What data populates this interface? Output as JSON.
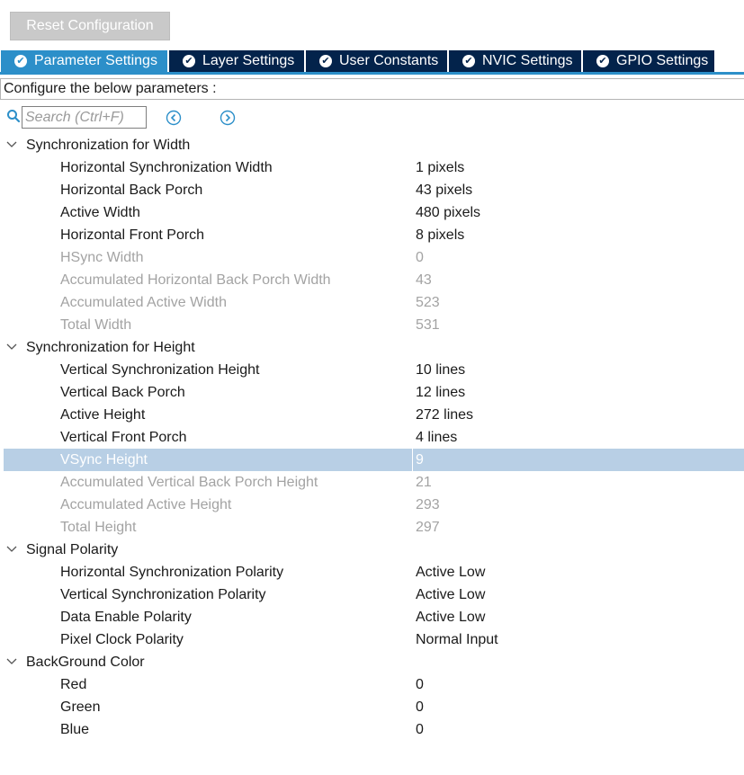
{
  "toolbar": {
    "reset_label": "Reset Configuration"
  },
  "tabs": [
    {
      "label": "Parameter Settings",
      "active": true
    },
    {
      "label": "Layer Settings",
      "active": false
    },
    {
      "label": "User Constants",
      "active": false
    },
    {
      "label": "NVIC Settings",
      "active": false
    },
    {
      "label": "GPIO Settings",
      "active": false
    }
  ],
  "configure_text": "Configure the below parameters :",
  "search": {
    "placeholder": "Search (Ctrl+F)"
  },
  "groups": [
    {
      "label": "Synchronization for Width",
      "params": [
        {
          "name": "Horizontal Synchronization Width",
          "value": "1 pixels",
          "editable": true
        },
        {
          "name": "Horizontal Back Porch",
          "value": "43 pixels",
          "editable": true
        },
        {
          "name": "Active Width",
          "value": "480 pixels",
          "editable": true
        },
        {
          "name": "Horizontal Front Porch",
          "value": "8 pixels",
          "editable": true
        },
        {
          "name": "HSync Width",
          "value": "0",
          "editable": false
        },
        {
          "name": "Accumulated Horizontal Back Porch Width",
          "value": "43",
          "editable": false
        },
        {
          "name": "Accumulated Active Width",
          "value": "523",
          "editable": false
        },
        {
          "name": "Total Width",
          "value": "531",
          "editable": false
        }
      ]
    },
    {
      "label": "Synchronization for Height",
      "params": [
        {
          "name": "Vertical Synchronization Height",
          "value": "10 lines",
          "editable": true
        },
        {
          "name": "Vertical Back Porch",
          "value": "12 lines",
          "editable": true
        },
        {
          "name": "Active Height",
          "value": "272 lines",
          "editable": true
        },
        {
          "name": "Vertical Front Porch",
          "value": "4 lines",
          "editable": true
        },
        {
          "name": "VSync Height",
          "value": "9",
          "editable": false,
          "selected": true
        },
        {
          "name": "Accumulated Vertical Back Porch Height",
          "value": "21",
          "editable": false
        },
        {
          "name": "Accumulated Active Height",
          "value": "293",
          "editable": false
        },
        {
          "name": "Total Height",
          "value": "297",
          "editable": false
        }
      ]
    },
    {
      "label": "Signal Polarity",
      "params": [
        {
          "name": "Horizontal Synchronization Polarity",
          "value": "Active Low",
          "editable": true
        },
        {
          "name": "Vertical Synchronization Polarity",
          "value": "Active Low",
          "editable": true
        },
        {
          "name": "Data Enable Polarity",
          "value": "Active Low",
          "editable": true
        },
        {
          "name": "Pixel Clock Polarity",
          "value": "Normal Input",
          "editable": true
        }
      ]
    },
    {
      "label": "BackGround Color",
      "params": [
        {
          "name": "Red",
          "value": "0",
          "editable": true
        },
        {
          "name": "Green",
          "value": "0",
          "editable": true
        },
        {
          "name": "Blue",
          "value": "0",
          "editable": true
        }
      ]
    }
  ],
  "colors": {
    "tab_inactive": "#03234b",
    "tab_active": "#2c8fc9",
    "selection": "#b8cfe5",
    "readonly_text": "#a3a3a3"
  },
  "icons": {
    "tab_status": "check-circle-icon",
    "search": "search-icon",
    "prev": "previous-match-icon",
    "next": "next-match-icon",
    "group_toggle": "chevron-down-icon"
  }
}
